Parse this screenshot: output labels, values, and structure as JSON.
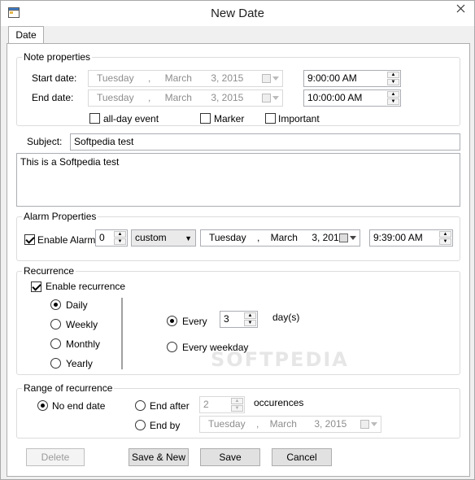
{
  "window": {
    "title": "New Date"
  },
  "tabs": [
    {
      "label": "Date"
    }
  ],
  "note_properties": {
    "title": "Note properties",
    "start_label": "Start date:",
    "start_date": {
      "day": "Tuesday",
      "sep": ",",
      "month": "March",
      "date": "3, 2015"
    },
    "start_time": "9:00:00 AM",
    "end_label": "End date:",
    "end_date": {
      "day": "Tuesday",
      "sep": ",",
      "month": "March",
      "date": "3, 2015"
    },
    "end_time": "10:00:00 AM",
    "all_day_label": "all-day event",
    "all_day_checked": false,
    "marker_label": "Marker",
    "marker_checked": false,
    "important_label": "Important",
    "important_checked": false
  },
  "subject": {
    "label": "Subject:",
    "value": "Softpedia test"
  },
  "body": {
    "value": "This is a Softpedia test"
  },
  "alarm": {
    "title": "Alarm Properties",
    "enable_label": "Enable Alarm",
    "enable_checked": true,
    "amount": "0",
    "unit": "custom",
    "date": {
      "day": "Tuesday",
      "sep": ",",
      "month": "March",
      "date": "3, 2015"
    },
    "time": "9:39:00 AM"
  },
  "recurrence": {
    "title": "Recurrence",
    "enable_label": "Enable recurrence",
    "enable_checked": true,
    "patterns": [
      {
        "label": "Daily",
        "checked": true
      },
      {
        "label": "Weekly",
        "checked": false
      },
      {
        "label": "Monthly",
        "checked": false
      },
      {
        "label": "Yearly",
        "checked": false
      }
    ],
    "every_label": "Every",
    "every_value": "3",
    "days_label": "day(s)",
    "every_weekday_label": "Every weekday"
  },
  "range": {
    "title": "Range of recurrence",
    "no_end_label": "No end date",
    "end_after_label": "End after",
    "end_after_value": "2",
    "occurrences_label": "occurences",
    "end_by_label": "End by",
    "end_by_date": {
      "day": "Tuesday",
      "sep": ",",
      "month": "March",
      "date": "3, 2015"
    }
  },
  "buttons": {
    "delete": "Delete",
    "save_new": "Save & New",
    "save": "Save",
    "cancel": "Cancel"
  },
  "watermark": "SOFTPEDIA",
  "colors": {
    "window_bg": "#f0f0f0",
    "page_bg": "#ffffff",
    "border": "#adadad"
  }
}
